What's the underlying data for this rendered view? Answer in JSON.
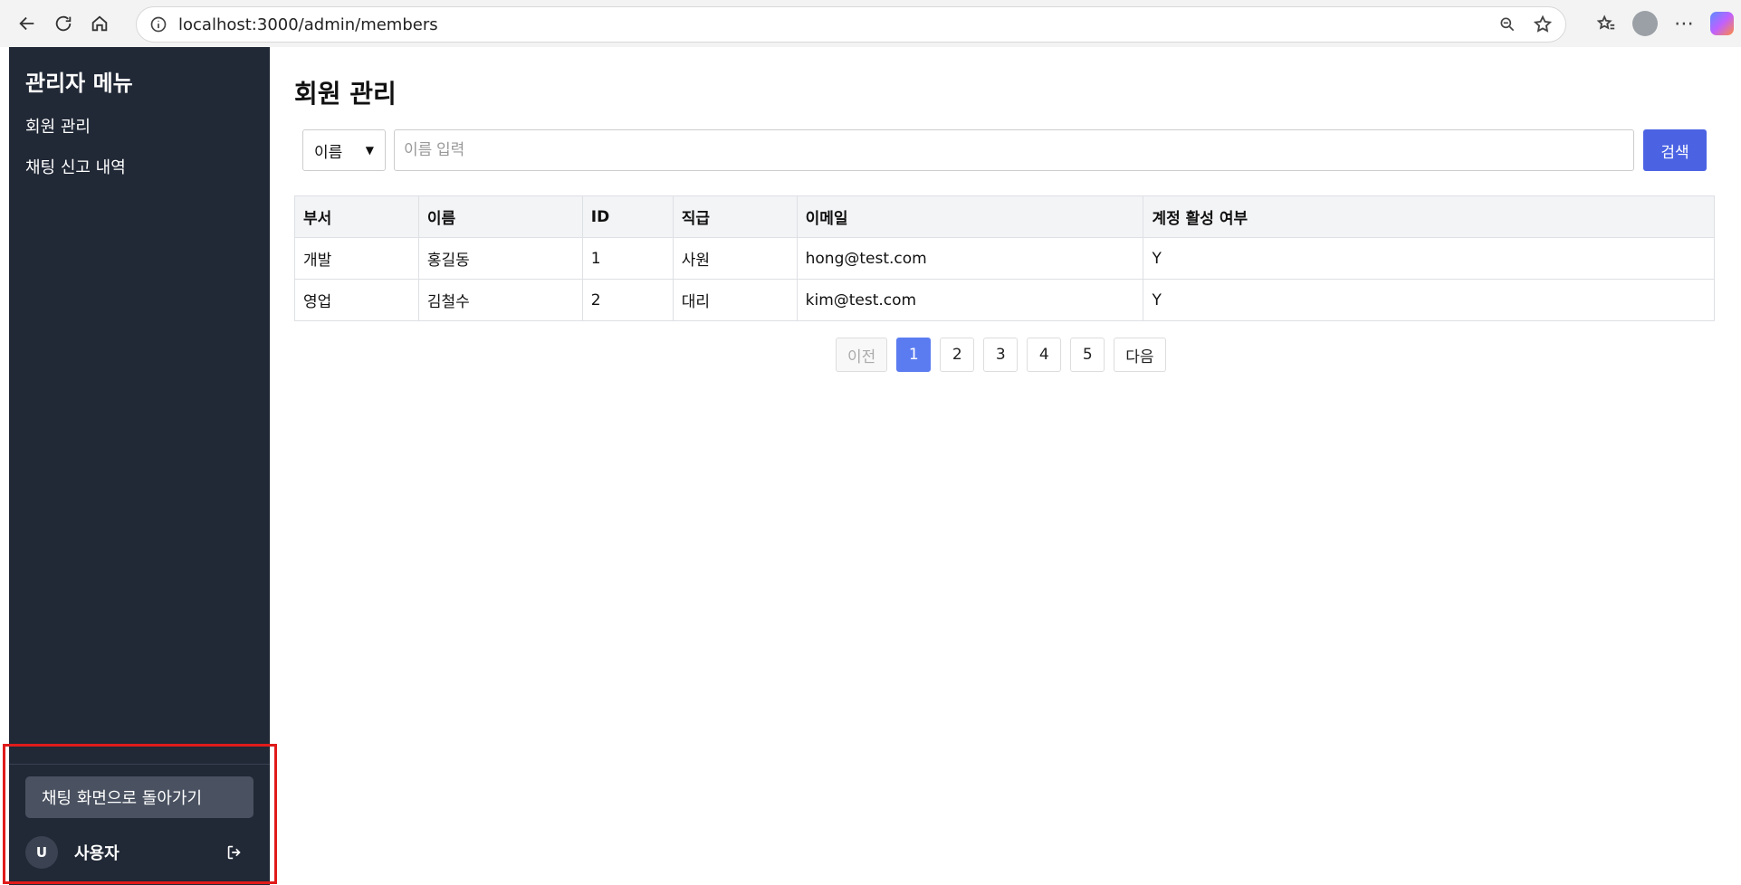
{
  "browser": {
    "url": "localhost:3000/admin/members"
  },
  "sidebar": {
    "title": "관리자 메뉴",
    "items": [
      {
        "label": "회원 관리"
      },
      {
        "label": "채팅 신고 내역"
      }
    ],
    "back_button": "채팅 화면으로 돌아가기",
    "user": {
      "avatar_letter": "U",
      "name": "사용자"
    }
  },
  "main": {
    "title": "회원 관리",
    "search": {
      "select_value": "이름",
      "placeholder": "이름 입력",
      "button": "검색"
    },
    "table": {
      "headers": [
        "부서",
        "이름",
        "ID",
        "직급",
        "이메일",
        "계정 활성 여부"
      ],
      "rows": [
        [
          "개발",
          "홍길동",
          "1",
          "사원",
          "hong@test.com",
          "Y"
        ],
        [
          "영업",
          "김철수",
          "2",
          "대리",
          "kim@test.com",
          "Y"
        ]
      ]
    },
    "pagination": {
      "prev": "이전",
      "pages": [
        "1",
        "2",
        "3",
        "4",
        "5"
      ],
      "active": "1",
      "next": "다음"
    }
  },
  "colors": {
    "sidebar_bg": "#212836",
    "accent": "#4b63e3",
    "highlight": "#e01b1b"
  }
}
